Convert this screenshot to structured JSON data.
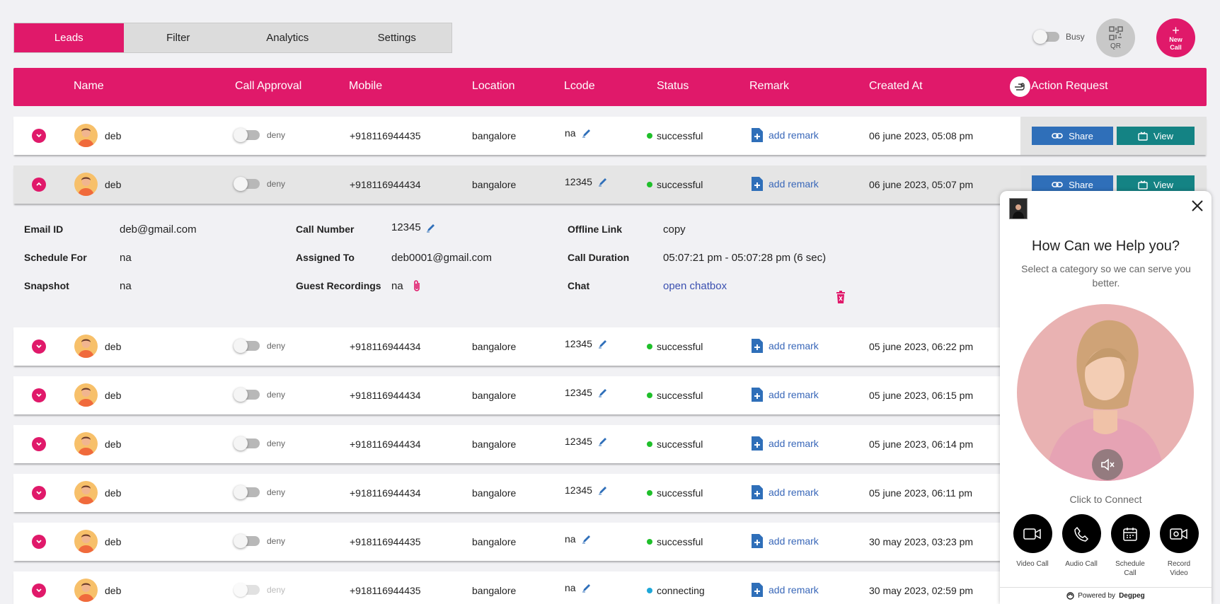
{
  "tabs": [
    {
      "label": "Leads",
      "active": true
    },
    {
      "label": "Filter",
      "active": false
    },
    {
      "label": "Analytics",
      "active": false
    },
    {
      "label": "Settings",
      "active": false
    }
  ],
  "top_controls": {
    "busy_label": "Busy",
    "qr_label": "QR",
    "new_call_line1": "New",
    "new_call_line2": "Call"
  },
  "columns": {
    "name": "Name",
    "call_approval": "Call Approval",
    "mobile": "Mobile",
    "location": "Location",
    "lcode": "Lcode",
    "status": "Status",
    "remark": "Remark",
    "created_at": "Created At",
    "action_request": "Action Request"
  },
  "actions": {
    "share": "Share",
    "view": "View"
  },
  "rows": [
    {
      "name": "deb",
      "approval": "deny",
      "mobile": "+918116944435",
      "location": "bangalore",
      "lcode": "na",
      "status": "successful",
      "remark": "add remark",
      "created": "06 june 2023, 05:08 pm"
    },
    {
      "name": "deb",
      "approval": "deny",
      "mobile": "+918116944434",
      "location": "bangalore",
      "lcode": "12345",
      "status": "successful",
      "remark": "add remark",
      "created": "06 june 2023, 05:07 pm"
    },
    {
      "name": "deb",
      "approval": "deny",
      "mobile": "+918116944434",
      "location": "bangalore",
      "lcode": "12345",
      "status": "successful",
      "remark": "add remark",
      "created": "05 june 2023, 06:22 pm"
    },
    {
      "name": "deb",
      "approval": "deny",
      "mobile": "+918116944434",
      "location": "bangalore",
      "lcode": "12345",
      "status": "successful",
      "remark": "add remark",
      "created": "05 june 2023, 06:15 pm"
    },
    {
      "name": "deb",
      "approval": "deny",
      "mobile": "+918116944434",
      "location": "bangalore",
      "lcode": "12345",
      "status": "successful",
      "remark": "add remark",
      "created": "05 june 2023, 06:14 pm"
    },
    {
      "name": "deb",
      "approval": "deny",
      "mobile": "+918116944434",
      "location": "bangalore",
      "lcode": "12345",
      "status": "successful",
      "remark": "add remark",
      "created": "05 june 2023, 06:11 pm"
    },
    {
      "name": "deb",
      "approval": "deny",
      "mobile": "+918116944435",
      "location": "bangalore",
      "lcode": "na",
      "status": "successful",
      "remark": "add remark",
      "created": "30 may 2023, 03:23 pm"
    },
    {
      "name": "deb",
      "approval": "deny",
      "mobile": "+918116944435",
      "location": "bangalore",
      "lcode": "na",
      "status": "connecting",
      "remark": "add remark",
      "created": "30 may 2023, 02:59 pm"
    }
  ],
  "detail": {
    "email_label": "Email ID",
    "email": "deb@gmail.com",
    "schedule_label": "Schedule For",
    "schedule": "na",
    "snapshot_label": "Snapshot",
    "snapshot": "na",
    "call_number_label": "Call Number",
    "call_number": "12345",
    "assigned_label": "Assigned To",
    "assigned": "deb0001@gmail.com",
    "guest_rec_label": "Guest Recordings",
    "guest_rec": "na",
    "offline_label": "Offline Link",
    "offline": "copy",
    "duration_label": "Call Duration",
    "duration": "05:07:21 pm - 05:07:28 pm (6 sec)",
    "chat_label": "Chat",
    "chat": "open chatbox"
  },
  "widget": {
    "title": "How Can we Help you?",
    "subtitle": "Select a category so we can serve you better.",
    "connect": "Click to Connect",
    "actions": [
      {
        "line1": "Video Call",
        "line2": "",
        "icon": "video-camera-icon"
      },
      {
        "line1": "Audio Call",
        "line2": "",
        "icon": "phone-icon"
      },
      {
        "line1": "Schedule",
        "line2": "Call",
        "icon": "calendar-icon"
      },
      {
        "line1": "Record",
        "line2": "Video",
        "icon": "record-video-icon"
      }
    ],
    "powered_prefix": "Powered by",
    "powered_brand": "Degpeg"
  },
  "colors": {
    "brand": "#e0196a",
    "share": "#2f6fb9",
    "view": "#148384",
    "status_success": "#1fbf2a",
    "status_connecting": "#1ea7d8"
  }
}
